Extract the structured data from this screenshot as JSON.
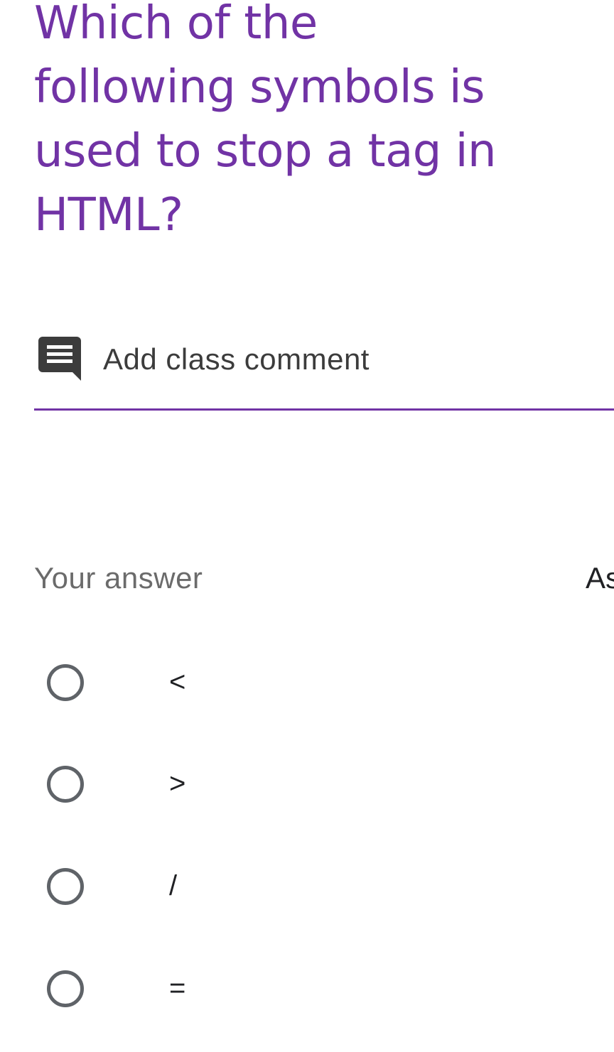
{
  "question": {
    "title": "Which of the following symbols is used to stop a tag in HTML?"
  },
  "class_comment": {
    "label": "Add class comment",
    "icon": "comment-icon"
  },
  "answer_section": {
    "heading": "Your answer",
    "side_label_partial": "As"
  },
  "options": [
    {
      "label": "<",
      "selected": false
    },
    {
      "label": ">",
      "selected": false
    },
    {
      "label": "/",
      "selected": false
    },
    {
      "label": "=",
      "selected": false
    }
  ],
  "colors": {
    "accent": "#7133a5",
    "text_primary": "#3c3c3c",
    "text_secondary": "#6b6b6b",
    "radio_border": "#5f6368",
    "option_text": "#202124"
  }
}
